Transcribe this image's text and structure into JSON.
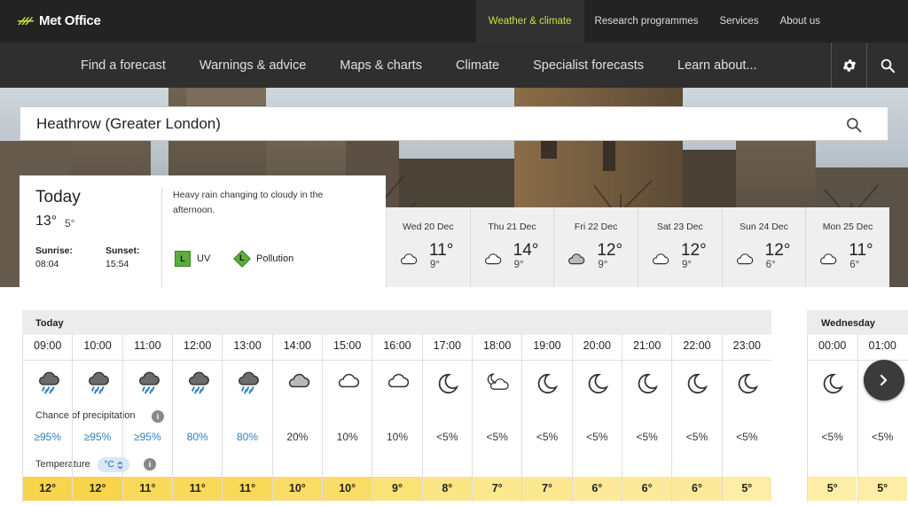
{
  "header": {
    "logo_text": "Met Office",
    "top_nav": [
      "Weather & climate",
      "Research programmes",
      "Services",
      "About us"
    ],
    "active_top": 0
  },
  "main_nav": [
    "Find a forecast",
    "Warnings & advice",
    "Maps & charts",
    "Climate",
    "Specialist forecasts",
    "Learn about..."
  ],
  "search": {
    "value": "Heathrow (Greater London)"
  },
  "today": {
    "title": "Today",
    "high": "13°",
    "low": "5°",
    "sunrise_label": "Sunrise:",
    "sunrise": "08:04",
    "sunset_label": "Sunset:",
    "sunset": "15:54",
    "summary": "Heavy rain changing to cloudy in the afternoon.",
    "uv_badge": "L",
    "uv_label": "UV",
    "pollution_badge": "L",
    "pollution_label": "Pollution"
  },
  "days": [
    {
      "name": "Wed 20 Dec",
      "high": "11°",
      "low": "9°",
      "icon": "cloud-icon"
    },
    {
      "name": "Thu 21 Dec",
      "high": "14°",
      "low": "9°",
      "icon": "cloud-icon"
    },
    {
      "name": "Fri 22 Dec",
      "high": "12°",
      "low": "9°",
      "icon": "grey-cloud-icon"
    },
    {
      "name": "Sat 23 Dec",
      "high": "12°",
      "low": "9°",
      "icon": "cloud-icon"
    },
    {
      "name": "Sun 24 Dec",
      "high": "12°",
      "low": "6°",
      "icon": "cloud-icon"
    },
    {
      "name": "Mon 25 Dec",
      "high": "11°",
      "low": "6°",
      "icon": "cloud-icon"
    }
  ],
  "hourly": {
    "today_label": "Today",
    "next_label": "Wednesday",
    "precip_label": "Chance of precipitation",
    "temp_label": "Temperature",
    "unit": "°C",
    "info_glyph": "i",
    "today_hours": [
      {
        "time": "09:00",
        "icon": "heavy-rain-icon",
        "precip": "≥95%",
        "temp": "12°",
        "color": "#f8d44c"
      },
      {
        "time": "10:00",
        "icon": "heavy-rain-icon",
        "precip": "≥95%",
        "temp": "12°",
        "color": "#f8d44c"
      },
      {
        "time": "11:00",
        "icon": "heavy-rain-icon",
        "precip": "≥95%",
        "temp": "11°",
        "color": "#f9d95a"
      },
      {
        "time": "12:00",
        "icon": "heavy-rain-icon",
        "precip": "80%",
        "temp": "11°",
        "color": "#f9d95a"
      },
      {
        "time": "13:00",
        "icon": "heavy-rain-icon",
        "precip": "80%",
        "temp": "11°",
        "color": "#f9d95a"
      },
      {
        "time": "14:00",
        "icon": "grey-cloud-icon",
        "precip": "20%",
        "temp": "10°",
        "color": "#fadd67"
      },
      {
        "time": "15:00",
        "icon": "cloud-icon",
        "precip": "10%",
        "temp": "10°",
        "color": "#fadd67"
      },
      {
        "time": "16:00",
        "icon": "cloud-icon",
        "precip": "10%",
        "temp": "9°",
        "color": "#fbe275"
      },
      {
        "time": "17:00",
        "icon": "moon-icon",
        "precip": "<5%",
        "temp": "8°",
        "color": "#fbe583"
      },
      {
        "time": "18:00",
        "icon": "moon-cloud-icon",
        "precip": "<5%",
        "temp": "7°",
        "color": "#fce88f"
      },
      {
        "time": "19:00",
        "icon": "moon-icon",
        "precip": "<5%",
        "temp": "7°",
        "color": "#fce88f"
      },
      {
        "time": "20:00",
        "icon": "moon-icon",
        "precip": "<5%",
        "temp": "6°",
        "color": "#fcea9a"
      },
      {
        "time": "21:00",
        "icon": "moon-icon",
        "precip": "<5%",
        "temp": "6°",
        "color": "#fcea9a"
      },
      {
        "time": "22:00",
        "icon": "moon-icon",
        "precip": "<5%",
        "temp": "6°",
        "color": "#fcea9a"
      },
      {
        "time": "23:00",
        "icon": "moon-icon",
        "precip": "<5%",
        "temp": "5°",
        "color": "#fdeda6"
      }
    ],
    "next_hours": [
      {
        "time": "00:00",
        "icon": "moon-icon",
        "precip": "<5%",
        "temp": "5°",
        "color": "#fdeda6"
      },
      {
        "time": "01:00",
        "icon": "moon-icon",
        "precip": "<5%",
        "temp": "5°",
        "color": "#fdeda6"
      }
    ]
  },
  "colors": {
    "accent": "#c2e046",
    "precip_blue": "#2c80c2",
    "uv_green": "#5aae3b"
  }
}
